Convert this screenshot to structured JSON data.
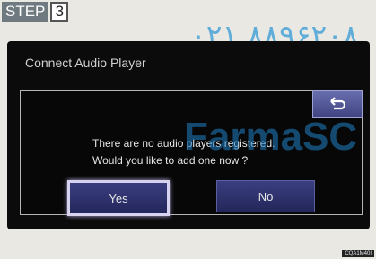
{
  "step": {
    "word": "STEP",
    "number": "3"
  },
  "watermark": {
    "digits": "۰۲۱ ۸۸۹۶۲۰۸",
    "brand": "FarmaSC"
  },
  "screen": {
    "title": "Connect Audio Player",
    "dialog": {
      "line1": "There are no audio players registered.",
      "line2": "Would you like to add one now ?",
      "yes_label": "Yes",
      "no_label": "No"
    }
  },
  "corner_code": "CQA1M40I",
  "icons": {
    "back": "return-arrow-icon"
  },
  "colors": {
    "button": "#2f3370",
    "focus_border": "#d7d2ee",
    "watermark": "#1f7fc7"
  }
}
